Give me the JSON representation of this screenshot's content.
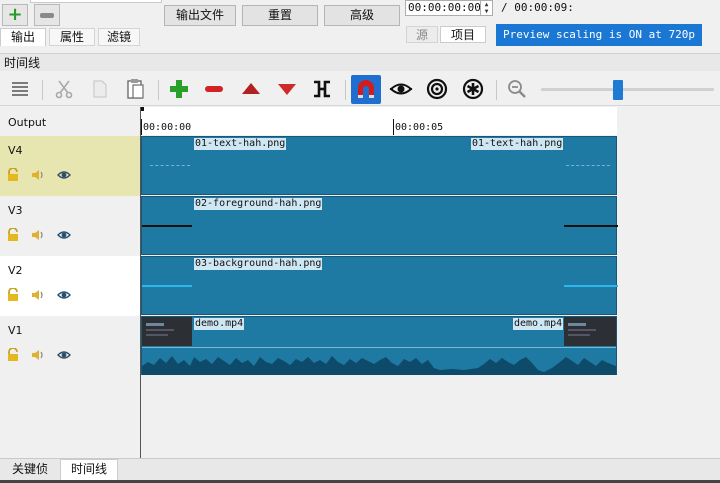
{
  "top": {
    "add_label": "+",
    "export_button": "输出文件",
    "reset_button": "重置",
    "advanced_button": "高级",
    "time_current": "00:00:00:00",
    "time_total": "/ 00:00:09:",
    "tabs": [
      "输出",
      "属性",
      "滤镜"
    ],
    "source_tab": "源",
    "project_tab": "项目",
    "preview_notice": "Preview scaling is ON at 720p"
  },
  "timeline": {
    "section_title": "时间线",
    "output_label": "Output",
    "ruler": [
      "00:00:00",
      "00:00:05"
    ],
    "tracks": [
      {
        "name": "V4",
        "clip_start": "01-text-hah.png",
        "clip_end": "01-text-hah.png"
      },
      {
        "name": "V3",
        "clip_start": "02-foreground-hah.png"
      },
      {
        "name": "V2",
        "clip_start": "03-background-hah.png"
      },
      {
        "name": "V1",
        "clip_start": "demo.mp4",
        "clip_end": "demo.mp4"
      }
    ]
  },
  "bottom_tabs": [
    "关键侦",
    "时间线"
  ],
  "colors": {
    "accent": "#1a78d4",
    "track_blue": "#1f7aa3",
    "selected_track": "#e8e6b0",
    "snap_active": "#1f6fd1"
  },
  "icons": [
    "menu-icon",
    "cut-icon",
    "copy-icon",
    "paste-icon",
    "append-icon",
    "remove-icon",
    "lift-icon",
    "overwrite-icon",
    "split-icon",
    "snap-icon",
    "scrub-icon",
    "ripple-icon",
    "ripple-all-icon",
    "zoom-out-icon",
    "lock-icon",
    "mute-icon",
    "hide-icon"
  ]
}
